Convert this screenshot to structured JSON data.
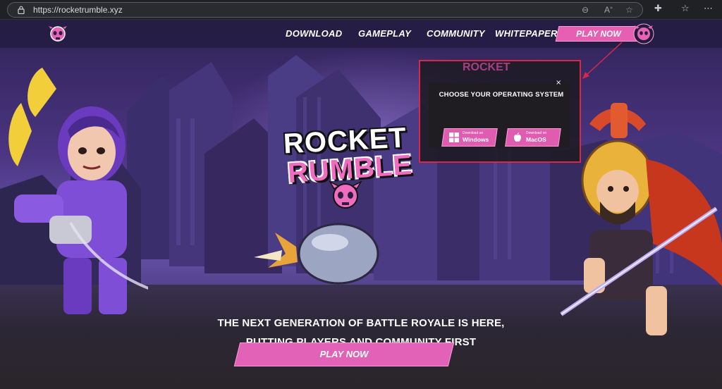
{
  "browser": {
    "url": "https://rocketrumble.xyz",
    "icons": [
      "lock-icon",
      "zoom-icon",
      "read-aloud-icon",
      "favorite-star-icon",
      "extensions-icon",
      "favorites-bar-icon",
      "more-menu-icon"
    ]
  },
  "nav": {
    "links": [
      "DOWNLOAD",
      "GAMEPLAY",
      "COMMUNITY",
      "WHITEPAPER"
    ],
    "play_label": "PLAY NOW"
  },
  "logo": {
    "line1": "ROCKET",
    "line2": "RUMBLE"
  },
  "modal": {
    "peek_text": "ROCKET",
    "title": "CHOOSE YOUR OPERATING SYSTEM",
    "close": "×",
    "options": [
      {
        "small": "Download on",
        "name": "Windows",
        "icon": "windows-icon"
      },
      {
        "small": "Download on",
        "name": "MacOS",
        "icon": "apple-icon"
      }
    ]
  },
  "hero": {
    "tagline_line1": "THE NEXT GENERATION OF BATTLE ROYALE IS HERE,",
    "tagline_line2": "PUTTING PLAYERS AND COMMUNITY FIRST",
    "cta_label": "PLAY NOW"
  },
  "colors": {
    "accent_pink": "#e262b8",
    "highlight_red": "#d8284a",
    "sky_purple": "#4a3480"
  }
}
